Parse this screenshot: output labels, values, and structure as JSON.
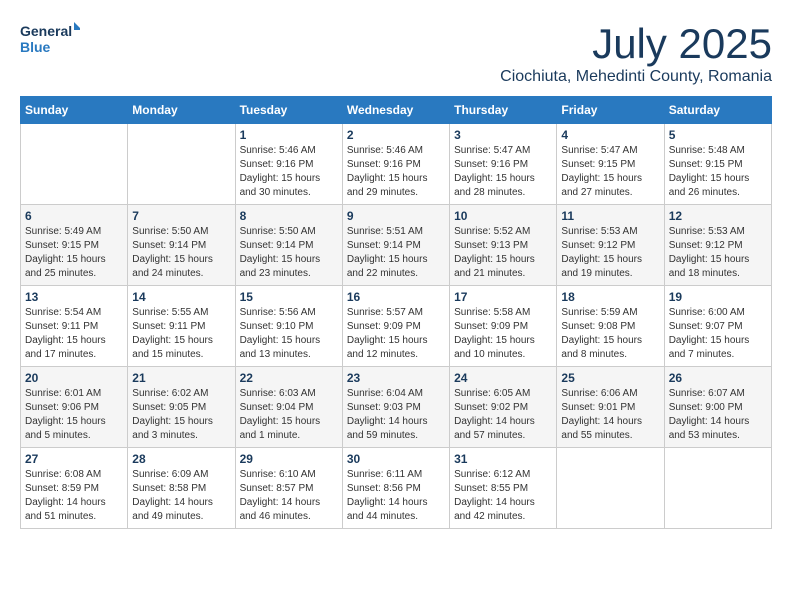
{
  "header": {
    "logo_line1": "General",
    "logo_line2": "Blue",
    "month": "July 2025",
    "location": "Ciochiuta, Mehedinti County, Romania"
  },
  "weekdays": [
    "Sunday",
    "Monday",
    "Tuesday",
    "Wednesday",
    "Thursday",
    "Friday",
    "Saturday"
  ],
  "weeks": [
    [
      {
        "day": "",
        "info": ""
      },
      {
        "day": "",
        "info": ""
      },
      {
        "day": "1",
        "info": "Sunrise: 5:46 AM\nSunset: 9:16 PM\nDaylight: 15 hours\nand 30 minutes."
      },
      {
        "day": "2",
        "info": "Sunrise: 5:46 AM\nSunset: 9:16 PM\nDaylight: 15 hours\nand 29 minutes."
      },
      {
        "day": "3",
        "info": "Sunrise: 5:47 AM\nSunset: 9:16 PM\nDaylight: 15 hours\nand 28 minutes."
      },
      {
        "day": "4",
        "info": "Sunrise: 5:47 AM\nSunset: 9:15 PM\nDaylight: 15 hours\nand 27 minutes."
      },
      {
        "day": "5",
        "info": "Sunrise: 5:48 AM\nSunset: 9:15 PM\nDaylight: 15 hours\nand 26 minutes."
      }
    ],
    [
      {
        "day": "6",
        "info": "Sunrise: 5:49 AM\nSunset: 9:15 PM\nDaylight: 15 hours\nand 25 minutes."
      },
      {
        "day": "7",
        "info": "Sunrise: 5:50 AM\nSunset: 9:14 PM\nDaylight: 15 hours\nand 24 minutes."
      },
      {
        "day": "8",
        "info": "Sunrise: 5:50 AM\nSunset: 9:14 PM\nDaylight: 15 hours\nand 23 minutes."
      },
      {
        "day": "9",
        "info": "Sunrise: 5:51 AM\nSunset: 9:14 PM\nDaylight: 15 hours\nand 22 minutes."
      },
      {
        "day": "10",
        "info": "Sunrise: 5:52 AM\nSunset: 9:13 PM\nDaylight: 15 hours\nand 21 minutes."
      },
      {
        "day": "11",
        "info": "Sunrise: 5:53 AM\nSunset: 9:12 PM\nDaylight: 15 hours\nand 19 minutes."
      },
      {
        "day": "12",
        "info": "Sunrise: 5:53 AM\nSunset: 9:12 PM\nDaylight: 15 hours\nand 18 minutes."
      }
    ],
    [
      {
        "day": "13",
        "info": "Sunrise: 5:54 AM\nSunset: 9:11 PM\nDaylight: 15 hours\nand 17 minutes."
      },
      {
        "day": "14",
        "info": "Sunrise: 5:55 AM\nSunset: 9:11 PM\nDaylight: 15 hours\nand 15 minutes."
      },
      {
        "day": "15",
        "info": "Sunrise: 5:56 AM\nSunset: 9:10 PM\nDaylight: 15 hours\nand 13 minutes."
      },
      {
        "day": "16",
        "info": "Sunrise: 5:57 AM\nSunset: 9:09 PM\nDaylight: 15 hours\nand 12 minutes."
      },
      {
        "day": "17",
        "info": "Sunrise: 5:58 AM\nSunset: 9:09 PM\nDaylight: 15 hours\nand 10 minutes."
      },
      {
        "day": "18",
        "info": "Sunrise: 5:59 AM\nSunset: 9:08 PM\nDaylight: 15 hours\nand 8 minutes."
      },
      {
        "day": "19",
        "info": "Sunrise: 6:00 AM\nSunset: 9:07 PM\nDaylight: 15 hours\nand 7 minutes."
      }
    ],
    [
      {
        "day": "20",
        "info": "Sunrise: 6:01 AM\nSunset: 9:06 PM\nDaylight: 15 hours\nand 5 minutes."
      },
      {
        "day": "21",
        "info": "Sunrise: 6:02 AM\nSunset: 9:05 PM\nDaylight: 15 hours\nand 3 minutes."
      },
      {
        "day": "22",
        "info": "Sunrise: 6:03 AM\nSunset: 9:04 PM\nDaylight: 15 hours\nand 1 minute."
      },
      {
        "day": "23",
        "info": "Sunrise: 6:04 AM\nSunset: 9:03 PM\nDaylight: 14 hours\nand 59 minutes."
      },
      {
        "day": "24",
        "info": "Sunrise: 6:05 AM\nSunset: 9:02 PM\nDaylight: 14 hours\nand 57 minutes."
      },
      {
        "day": "25",
        "info": "Sunrise: 6:06 AM\nSunset: 9:01 PM\nDaylight: 14 hours\nand 55 minutes."
      },
      {
        "day": "26",
        "info": "Sunrise: 6:07 AM\nSunset: 9:00 PM\nDaylight: 14 hours\nand 53 minutes."
      }
    ],
    [
      {
        "day": "27",
        "info": "Sunrise: 6:08 AM\nSunset: 8:59 PM\nDaylight: 14 hours\nand 51 minutes."
      },
      {
        "day": "28",
        "info": "Sunrise: 6:09 AM\nSunset: 8:58 PM\nDaylight: 14 hours\nand 49 minutes."
      },
      {
        "day": "29",
        "info": "Sunrise: 6:10 AM\nSunset: 8:57 PM\nDaylight: 14 hours\nand 46 minutes."
      },
      {
        "day": "30",
        "info": "Sunrise: 6:11 AM\nSunset: 8:56 PM\nDaylight: 14 hours\nand 44 minutes."
      },
      {
        "day": "31",
        "info": "Sunrise: 6:12 AM\nSunset: 8:55 PM\nDaylight: 14 hours\nand 42 minutes."
      },
      {
        "day": "",
        "info": ""
      },
      {
        "day": "",
        "info": ""
      }
    ]
  ]
}
